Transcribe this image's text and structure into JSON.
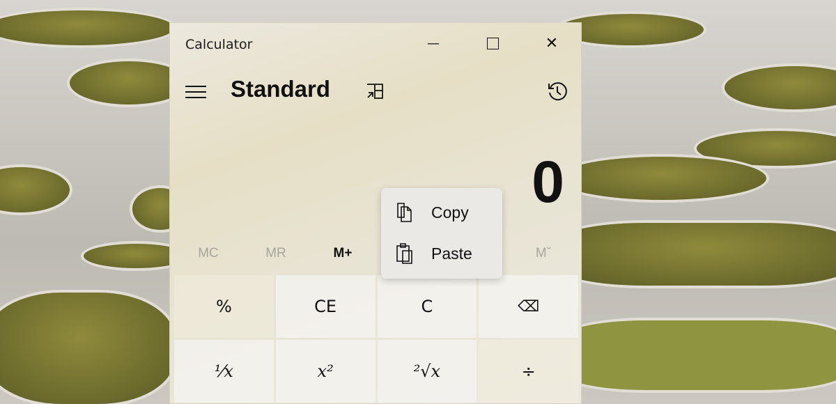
{
  "window": {
    "title": "Calculator",
    "minimize": "—",
    "maximize": "☐",
    "close": "✕"
  },
  "header": {
    "mode": "Standard"
  },
  "display": {
    "value": "0"
  },
  "memory": [
    "MC",
    "MR",
    "M+",
    "Mˇ"
  ],
  "keys": [
    "%",
    "CE",
    "C",
    "⌫",
    "¹⁄x",
    "x²",
    "²√x",
    "÷"
  ],
  "context_menu": {
    "items": [
      {
        "label": "Copy",
        "icon": "copy-icon"
      },
      {
        "label": "Paste",
        "icon": "paste-icon"
      }
    ]
  }
}
